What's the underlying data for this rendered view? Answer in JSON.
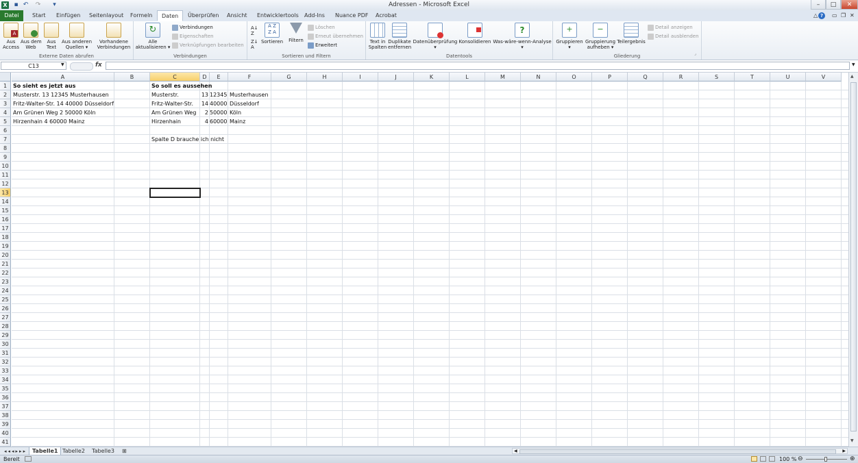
{
  "window": {
    "title": "Adressen - Microsoft Excel"
  },
  "quick_access": {
    "undo": "↶",
    "redo": "↷",
    "customize": "▾"
  },
  "window_controls": {
    "minimize": "–",
    "maximize": "□",
    "close": "✕"
  },
  "tabs": [
    "Datei",
    "Start",
    "Einfügen",
    "Seitenlayout",
    "Formeln",
    "Daten",
    "Überprüfen",
    "Ansicht",
    "Entwicklertools",
    "Add-Ins",
    "Nuance PDF",
    "Acrobat"
  ],
  "ribbon": {
    "groups": {
      "external": "Externe Daten abrufen",
      "connections": "Verbindungen",
      "sort_filter": "Sortieren und Filtern",
      "datatools": "Datentools",
      "outline": "Gliederung"
    },
    "external": {
      "access": "Aus\nAccess",
      "web": "Aus dem\nWeb",
      "text": "Aus\nText",
      "other": "Aus anderen\nQuellen ▾",
      "existing": "Vorhandene\nVerbindungen"
    },
    "connections": {
      "refresh_all": "Alle\naktualisieren ▾",
      "connections": "Verbindungen",
      "properties": "Eigenschaften",
      "edit_links": "Verknüpfungen bearbeiten"
    },
    "sort": {
      "sort": "Sortieren",
      "filter": "Filtern",
      "clear": "Löschen",
      "reapply": "Erneut übernehmen",
      "advanced": "Erweitert"
    },
    "datatools": {
      "text_to_columns": "Text in\nSpalten",
      "remove_duplicates": "Duplikate\nentfernen",
      "validation": "Datenüberprüfung\n▾",
      "consolidate": "Konsolidieren",
      "whatif": "Was-wäre-wenn-Analyse\n▾"
    },
    "outline": {
      "group": "Gruppieren\n▾",
      "ungroup": "Gruppierung\naufheben ▾",
      "subtotal": "Teilergebnis",
      "show_detail": "Detail anzeigen",
      "hide_detail": "Detail ausblenden"
    }
  },
  "formula_bar": {
    "name_box": "C13",
    "fx": "fx",
    "value": ""
  },
  "columns": [
    "A",
    "B",
    "C",
    "D",
    "E",
    "F",
    "G",
    "H",
    "I",
    "J",
    "K",
    "L",
    "M",
    "N",
    "O",
    "P",
    "Q",
    "R",
    "S",
    "T",
    "U",
    "V"
  ],
  "selected_column": "C",
  "selected_row": 13,
  "cells": [
    {
      "ref": "A1",
      "value": "So sieht es jetzt aus",
      "bold": true
    },
    {
      "ref": "A2",
      "value": "Musterstr. 13 12345 Musterhausen"
    },
    {
      "ref": "A3",
      "value": "Fritz-Walter-Str. 14 40000 Düsseldorf"
    },
    {
      "ref": "A4",
      "value": "Am Grünen Weg 2 50000 Köln"
    },
    {
      "ref": "A5",
      "value": "Hirzenhain 4 60000 Mainz"
    },
    {
      "ref": "C1",
      "value": "So soll es aussehen",
      "bold": true
    },
    {
      "ref": "C2",
      "value": "Musterstr."
    },
    {
      "ref": "C3",
      "value": "Fritz-Walter-Str."
    },
    {
      "ref": "C4",
      "value": "Am Grünen Weg"
    },
    {
      "ref": "C5",
      "value": "Hirzenhain"
    },
    {
      "ref": "D2",
      "value": "13",
      "align": "right"
    },
    {
      "ref": "D3",
      "value": "14",
      "align": "right"
    },
    {
      "ref": "D4",
      "value": "2",
      "align": "right"
    },
    {
      "ref": "D5",
      "value": "4",
      "align": "right"
    },
    {
      "ref": "E2",
      "value": "12345",
      "align": "right"
    },
    {
      "ref": "E3",
      "value": "40000",
      "align": "right"
    },
    {
      "ref": "E4",
      "value": "50000",
      "align": "right"
    },
    {
      "ref": "E5",
      "value": "60000",
      "align": "right"
    },
    {
      "ref": "F2",
      "value": "Musterhausen"
    },
    {
      "ref": "F3",
      "value": "Düsseldorf"
    },
    {
      "ref": "F4",
      "value": "Köln"
    },
    {
      "ref": "F5",
      "value": "Mainz"
    },
    {
      "ref": "C7",
      "value": "Spalte D brauche ich nicht"
    }
  ],
  "sheets": [
    "Tabelle1",
    "Tabelle2",
    "Tabelle3"
  ],
  "active_sheet": "Tabelle1",
  "status": {
    "mode": "Bereit",
    "zoom": "100 %"
  },
  "colors": {
    "file_tab": "#2a7a2e",
    "selection_header": "#f7cf6b",
    "excel_icon": "#1e7145"
  }
}
